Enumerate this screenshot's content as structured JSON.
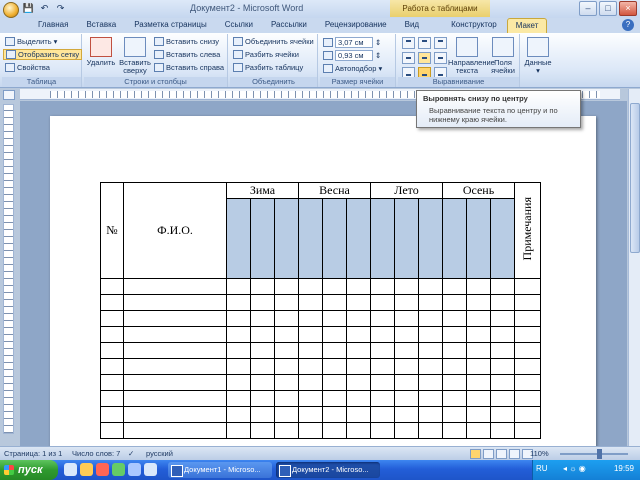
{
  "window": {
    "app_title": "Документ2 - Microsoft Word",
    "context_title": "Работа с таблицами"
  },
  "tabs": [
    {
      "label": "Главная"
    },
    {
      "label": "Вставка"
    },
    {
      "label": "Разметка страницы"
    },
    {
      "label": "Ссылки"
    },
    {
      "label": "Рассылки"
    },
    {
      "label": "Рецензирование"
    },
    {
      "label": "Вид"
    },
    {
      "label": "Конструктор"
    },
    {
      "label": "Макет"
    }
  ],
  "ribbon": {
    "table_group": {
      "label": "Таблица",
      "select": "Выделить",
      "show_grid": "Отобразить сетку",
      "properties": "Свойства"
    },
    "rows_cols_group": {
      "label": "Строки и столбцы",
      "delete": "Удалить",
      "insert_above": "Вставить сверху",
      "insert_below": "Вставить снизу",
      "insert_left": "Вставить слева",
      "insert_right": "Вставить справа"
    },
    "merge_group": {
      "label": "Объединить",
      "merge_cells": "Объединить ячейки",
      "split_cells": "Разбить ячейки",
      "split_table": "Разбить таблицу"
    },
    "cell_size_group": {
      "label": "Размер ячейки",
      "height": "3,07 см",
      "width": "0,93 см",
      "autofit": "Автоподбор"
    },
    "alignment_group": {
      "label": "Выравнивание",
      "text_direction": "Направление текста",
      "cell_margins": "Поля ячейки"
    },
    "data_group": {
      "label": "Данные"
    }
  },
  "tooltip": {
    "title": "Выровнять снизу по центру",
    "body": "Выравнивание текста по центру и по нижнему краю ячейки."
  },
  "doc_table": {
    "col_number": "№",
    "col_name": "Ф.И.О.",
    "seasons": [
      "Зима",
      "Весна",
      "Лето",
      "Осень"
    ],
    "col_notes": "Примечания",
    "data_rows": 10
  },
  "statusbar": {
    "page": "Страница: 1 из 1",
    "words": "Число слов: 7",
    "language": "русский",
    "zoom": "110%"
  },
  "taskbar": {
    "start": "пуск",
    "tasks": [
      "Документ1 - Microso...",
      "Документ2 - Microso..."
    ],
    "lang": "RU",
    "time": "19:59"
  }
}
